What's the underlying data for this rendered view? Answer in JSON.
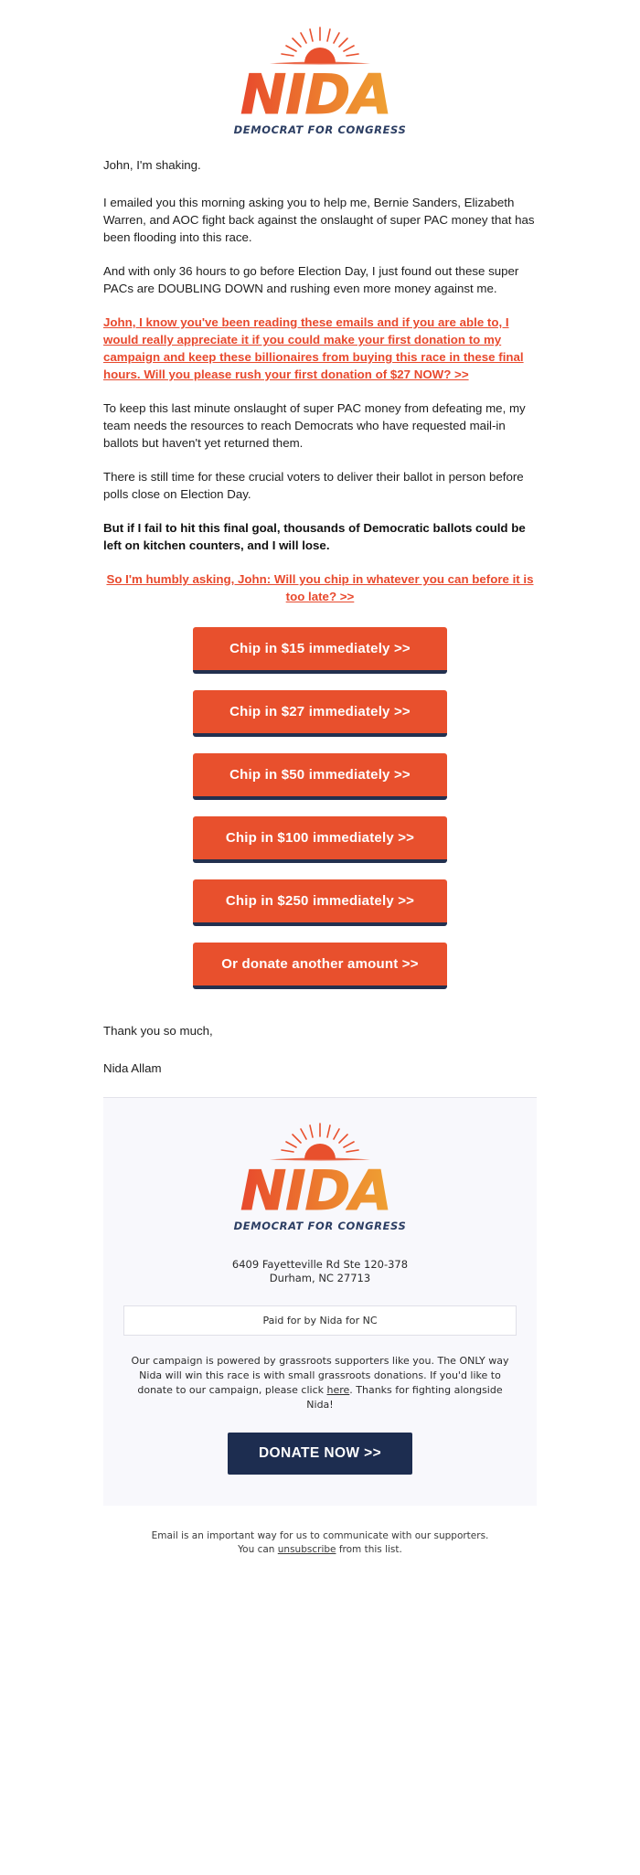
{
  "logo": {
    "wordmark": "NIDA",
    "tagline": "DEMOCRAT FOR CONGRESS",
    "sun_icon": "sunburst-icon",
    "colors": {
      "orange_dark": "#e8502d",
      "orange_light": "#ef9a33",
      "navy": "#2c3e63"
    }
  },
  "body": {
    "greeting": "John, I'm shaking.",
    "para1": "I emailed you this morning asking you to help me, Bernie Sanders, Elizabeth Warren, and AOC fight back against the onslaught of super PAC money that has been flooding into this race.",
    "para2": "And with only 36 hours to go before Election Day, I just found out these super PACs are DOUBLING DOWN and rushing even more money against me.",
    "link1": "John, I know you've been reading these emails and if you are able to, I would really appreciate it if you could make your first donation to my campaign and keep these billionaires from buying this race in these final hours. Will you please rush your first donation of $27 NOW? >>",
    "para3": "To keep this last minute onslaught of super PAC money from defeating me, my team needs the resources to reach Democrats who have requested mail-in ballots but haven't yet returned them.",
    "para4": "There is still time for these crucial voters to deliver their ballot in person before polls close on Election Day.",
    "bold_para": "But if I fail to hit this final goal, thousands of Democratic ballots could be left on kitchen counters, and I will lose.",
    "link2": "So I'm humbly asking, John: Will you chip in whatever you can before it is too late? >>",
    "signoff": "Thank you so much,",
    "signature": "Nida Allam"
  },
  "donate_buttons": [
    {
      "label": "Chip in $15 immediately >>",
      "amount": "15"
    },
    {
      "label": "Chip in $27 immediately >>",
      "amount": "27"
    },
    {
      "label": "Chip in $50 immediately >>",
      "amount": "50"
    },
    {
      "label": "Chip in $100 immediately >>",
      "amount": "100"
    },
    {
      "label": "Chip in $250 immediately >>",
      "amount": "250"
    },
    {
      "label": "Or donate another amount  >>",
      "amount": "other"
    }
  ],
  "footer": {
    "address_line1": "6409 Fayetteville Rd Ste 120-378",
    "address_line2": "Durham, NC 27713",
    "paid_for": "Paid for by Nida for NC",
    "disclaimer_before": "Our campaign is powered by grassroots supporters like you. The ONLY way Nida will win this race is with small grassroots donations. If you'd like to donate to our campaign, please click ",
    "disclaimer_link": "here",
    "disclaimer_after": ". Thanks for fighting alongside Nida!",
    "donate_now_label": "DONATE NOW >>"
  },
  "unsubscribe": {
    "line1": "Email is an important way for us to communicate with our supporters.",
    "line2_before": "You can ",
    "line2_link": "unsubscribe",
    "line2_after": " from this list."
  }
}
